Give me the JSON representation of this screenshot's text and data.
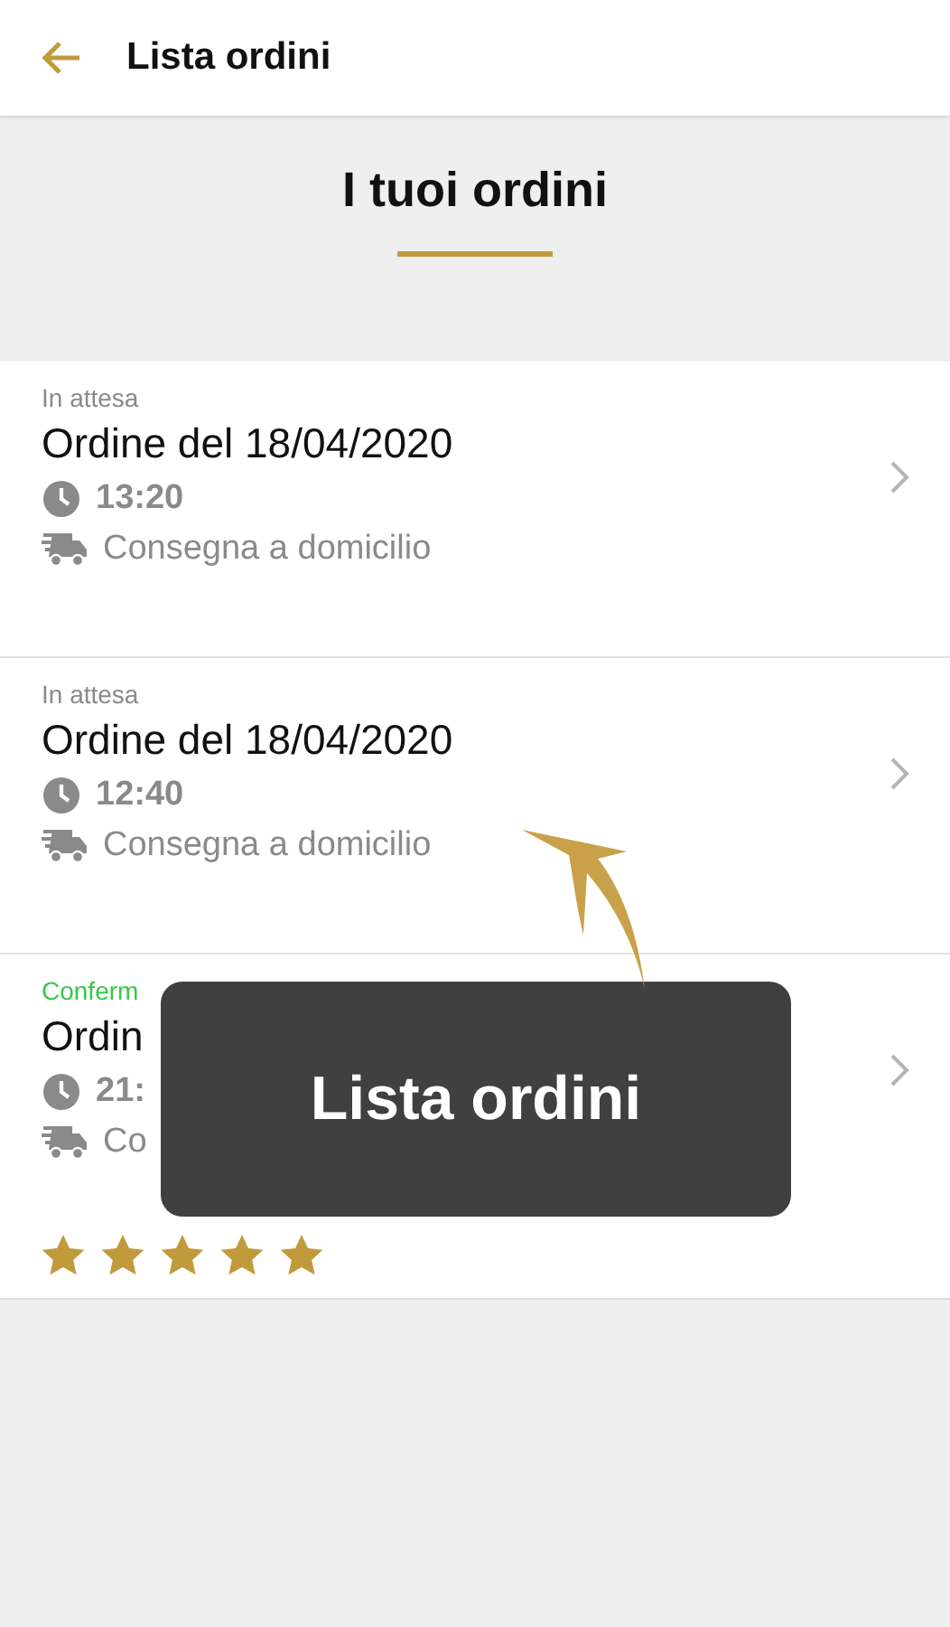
{
  "header": {
    "title": "Lista ordini"
  },
  "banner": {
    "title": "I tuoi ordini"
  },
  "orders": [
    {
      "status": "In attesa",
      "color": "#8a8a8a",
      "title": "Ordine del 18/04/2020",
      "time": "13:20",
      "delivery": "Consegna a domicilio"
    },
    {
      "status": "In attesa",
      "color": "#8a8a8a",
      "title": "Ordine del 18/04/2020",
      "time": "12:40",
      "delivery": "Consegna a domicilio"
    },
    {
      "status": "Conferm",
      "color": "#35c84a",
      "title": "Ordin",
      "time": "21:",
      "delivery": "Co",
      "stars": 5
    }
  ],
  "overlay": {
    "caption": "Lista ordini"
  }
}
